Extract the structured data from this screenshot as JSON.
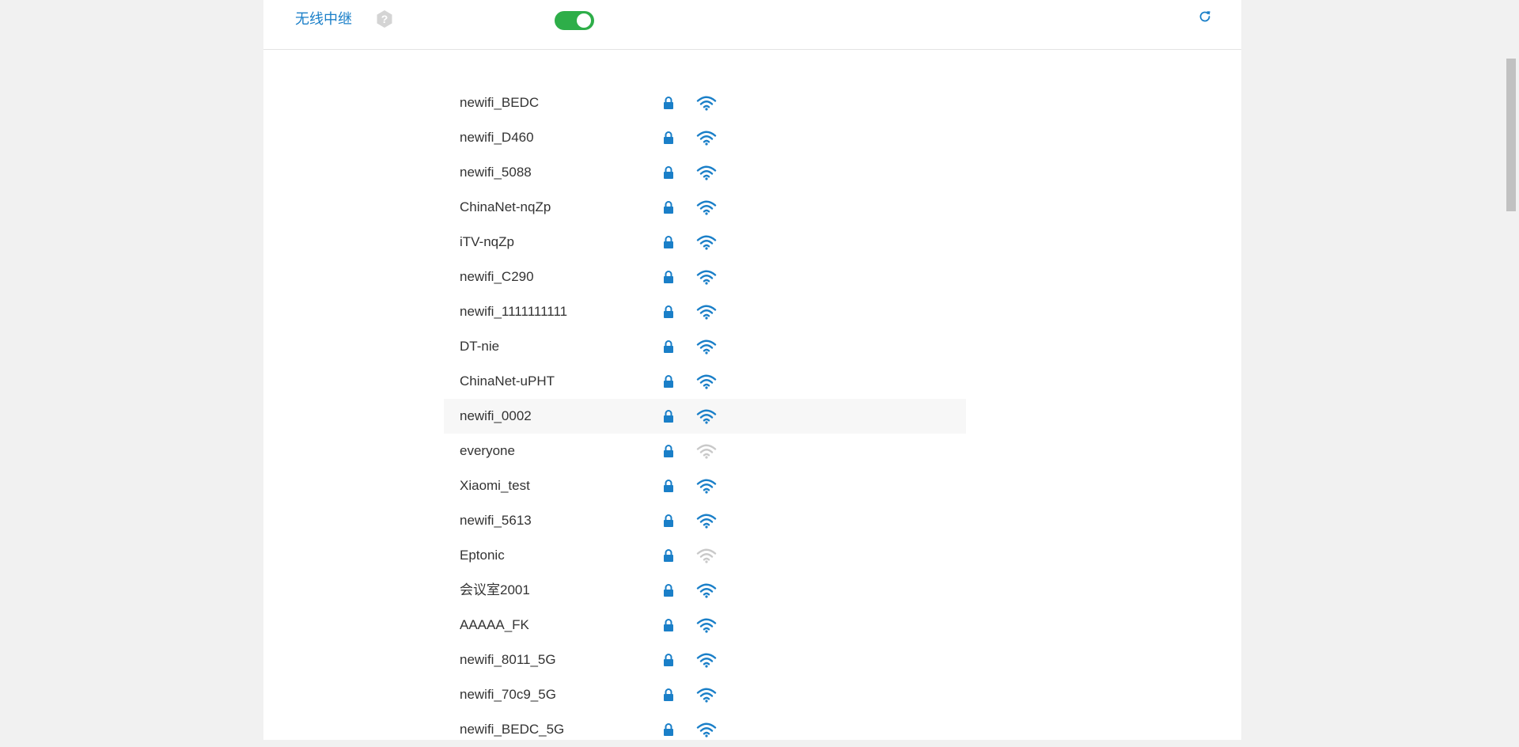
{
  "header": {
    "title": "无线中继",
    "toggle_on": true,
    "colors": {
      "accent": "#1a7fc8",
      "toggle": "#2eae49"
    }
  },
  "networks": [
    {
      "ssid": "newifi_BEDC",
      "secured": true,
      "signal": "strong"
    },
    {
      "ssid": "newifi_D460",
      "secured": true,
      "signal": "strong"
    },
    {
      "ssid": "newifi_5088",
      "secured": true,
      "signal": "strong"
    },
    {
      "ssid": "ChinaNet-nqZp",
      "secured": true,
      "signal": "strong"
    },
    {
      "ssid": "iTV-nqZp",
      "secured": true,
      "signal": "strong"
    },
    {
      "ssid": "newifi_C290",
      "secured": true,
      "signal": "strong"
    },
    {
      "ssid": "newifi_1111111111",
      "secured": true,
      "signal": "strong"
    },
    {
      "ssid": "DT-nie",
      "secured": true,
      "signal": "strong"
    },
    {
      "ssid": "ChinaNet-uPHT",
      "secured": true,
      "signal": "strong"
    },
    {
      "ssid": "newifi_0002",
      "secured": true,
      "signal": "strong",
      "highlighted": true
    },
    {
      "ssid": "everyone",
      "secured": true,
      "signal": "weak"
    },
    {
      "ssid": "Xiaomi_test",
      "secured": true,
      "signal": "strong"
    },
    {
      "ssid": "newifi_5613",
      "secured": true,
      "signal": "strong"
    },
    {
      "ssid": "Eptonic",
      "secured": true,
      "signal": "weak"
    },
    {
      "ssid": "会议室2001",
      "secured": true,
      "signal": "strong"
    },
    {
      "ssid": "AAAAA_FK",
      "secured": true,
      "signal": "strong"
    },
    {
      "ssid": "newifi_8011_5G",
      "secured": true,
      "signal": "strong"
    },
    {
      "ssid": "newifi_70c9_5G",
      "secured": true,
      "signal": "strong"
    },
    {
      "ssid": "newifi_BEDC_5G",
      "secured": true,
      "signal": "strong"
    }
  ],
  "icons": {
    "help": "help-icon",
    "refresh": "refresh-icon",
    "lock": "lock-icon",
    "wifi": "wifi-signal-icon"
  }
}
